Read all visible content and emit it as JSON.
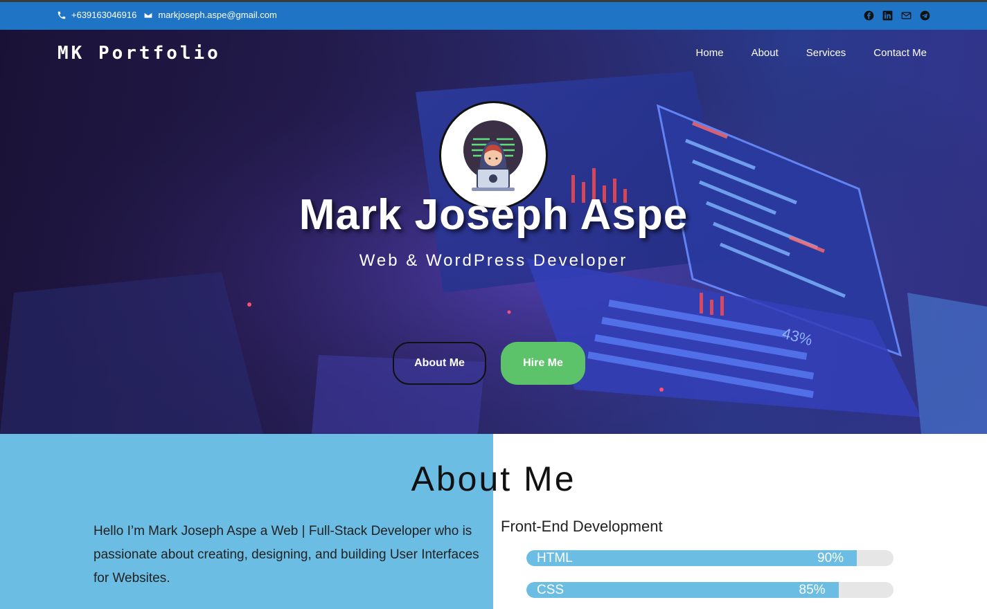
{
  "topbar": {
    "phone": "+639163046916",
    "email": "markjoseph.aspe@gmail.com",
    "socials": [
      "facebook-icon",
      "linkedin-icon",
      "mail-icon",
      "telegram-icon"
    ]
  },
  "header": {
    "brand": "MK Portfolio",
    "nav": [
      "Home",
      "About",
      "Services",
      "Contact Me"
    ]
  },
  "hero": {
    "name": "Mark Joseph Aspe",
    "role": "Web & WordPress Developer",
    "about_button": "About Me",
    "hire_button": "Hire Me",
    "laptop_badge": "43%"
  },
  "about": {
    "title": "About Me",
    "text": "Hello I’m Mark Joseph Aspe a Web | Full-Stack Developer who is passionate about creating, designing, and building User Interfaces for Websites.",
    "frontend_title": "Front-End Development",
    "skills": [
      {
        "label": "HTML",
        "percent_text": "90%",
        "percent": 90
      },
      {
        "label": "CSS",
        "percent_text": "85%",
        "percent": 85
      }
    ]
  },
  "colors": {
    "topbar": "#1f74c5",
    "about_panel": "#6bbde3",
    "hire_button": "#5cc36a"
  }
}
